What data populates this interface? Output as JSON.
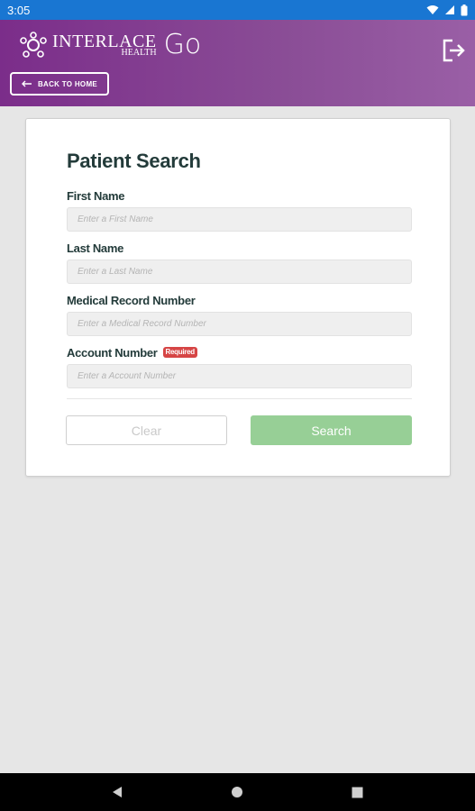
{
  "status_bar": {
    "time": "3:05",
    "icons": [
      "wifi-icon",
      "signal-icon",
      "battery-icon"
    ]
  },
  "header": {
    "logo_main": "INTERLACE",
    "logo_sub": "HEALTH",
    "logo_go": "Go",
    "back_label": "BACK TO HOME",
    "gradient": [
      "#7b2d8a",
      "#9a5fa6"
    ]
  },
  "form": {
    "title": "Patient Search",
    "fields": [
      {
        "label": "First Name",
        "placeholder": "Enter a First Name"
      },
      {
        "label": "Last Name",
        "placeholder": "Enter a Last Name"
      },
      {
        "label": "Medical Record Number",
        "placeholder": "Enter a Medical Record Number"
      },
      {
        "label": "Account Number",
        "placeholder": "Enter a Account Number",
        "badge": "Required"
      }
    ],
    "clear_label": "Clear",
    "search_label": "Search"
  },
  "colors": {
    "accent_green": "#97cf96",
    "required_red": "#d64545",
    "status_blue": "#1976d2"
  }
}
